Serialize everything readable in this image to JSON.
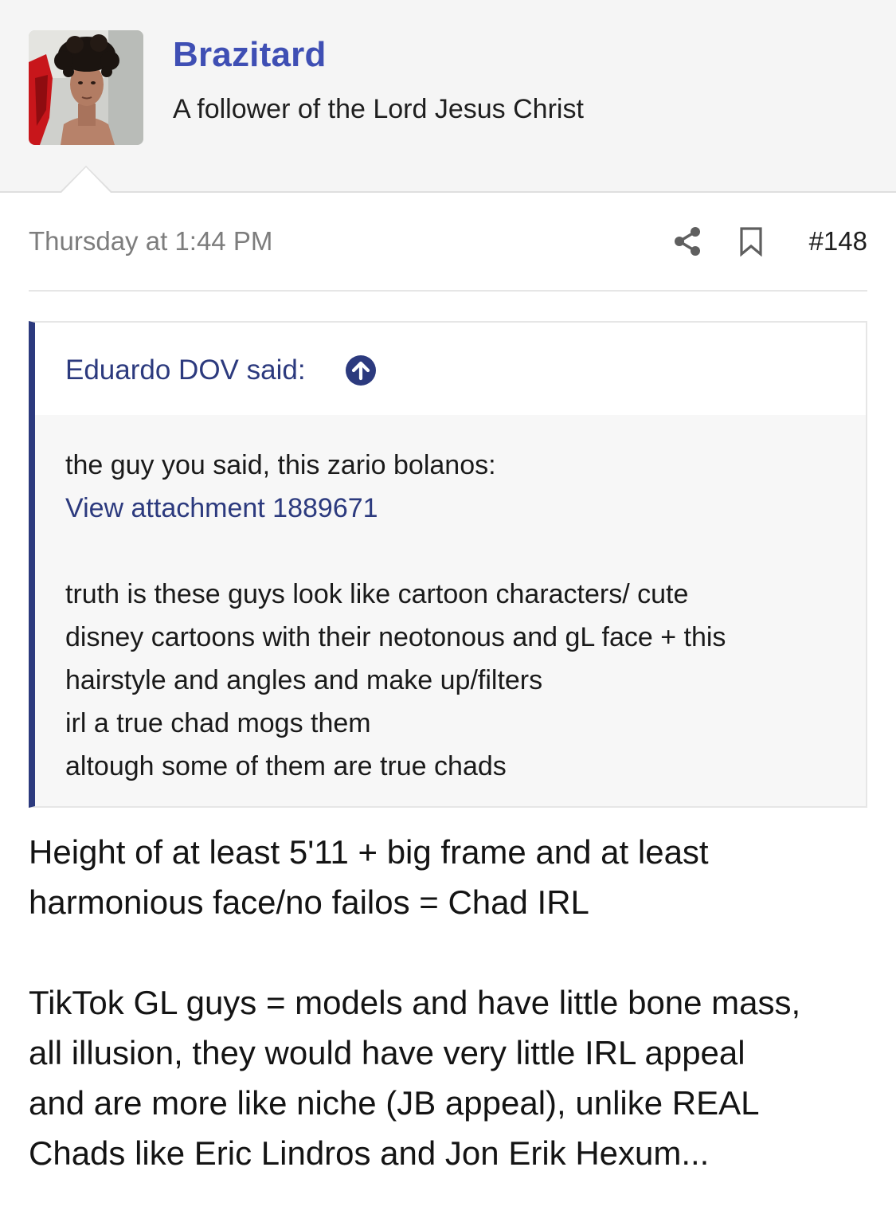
{
  "user": {
    "name": "Brazitard",
    "title": "A follower of the Lord Jesus Christ"
  },
  "meta": {
    "timestamp": "Thursday at 1:44 PM",
    "post_number": "#148",
    "share_icon": "share-icon",
    "bookmark_icon": "bookmark-icon"
  },
  "quote": {
    "author_label": "Eduardo DOV said:",
    "jump_icon": "arrow-up-circle-icon",
    "line1": "the guy you said, this zario bolanos:",
    "attachment_label": "View attachment 1889671",
    "lines": [
      "truth is these guys look like cartoon characters/ cute",
      "disney cartoons with their neotonous and gL face + this",
      "hairstyle and angles and make up/filters",
      "irl a true chad mogs them",
      "altough some of them are true chads"
    ]
  },
  "post": {
    "para1": [
      "Height of at least 5'11 + big frame and at least",
      "harmonious face/no failos = Chad IRL"
    ],
    "para2": [
      "TikTok GL guys = models and have little bone mass,",
      "all illusion, they would have very little IRL appeal",
      "and are more like niche (JB appeal), unlike REAL",
      "Chads like Eric Lindros and Jon Erik Hexum..."
    ]
  },
  "colors": {
    "username": "#3f4fb4",
    "quote_accent": "#2c3a7e",
    "header_bg": "#f5f5f5",
    "muted_text": "#7d7d7d"
  }
}
